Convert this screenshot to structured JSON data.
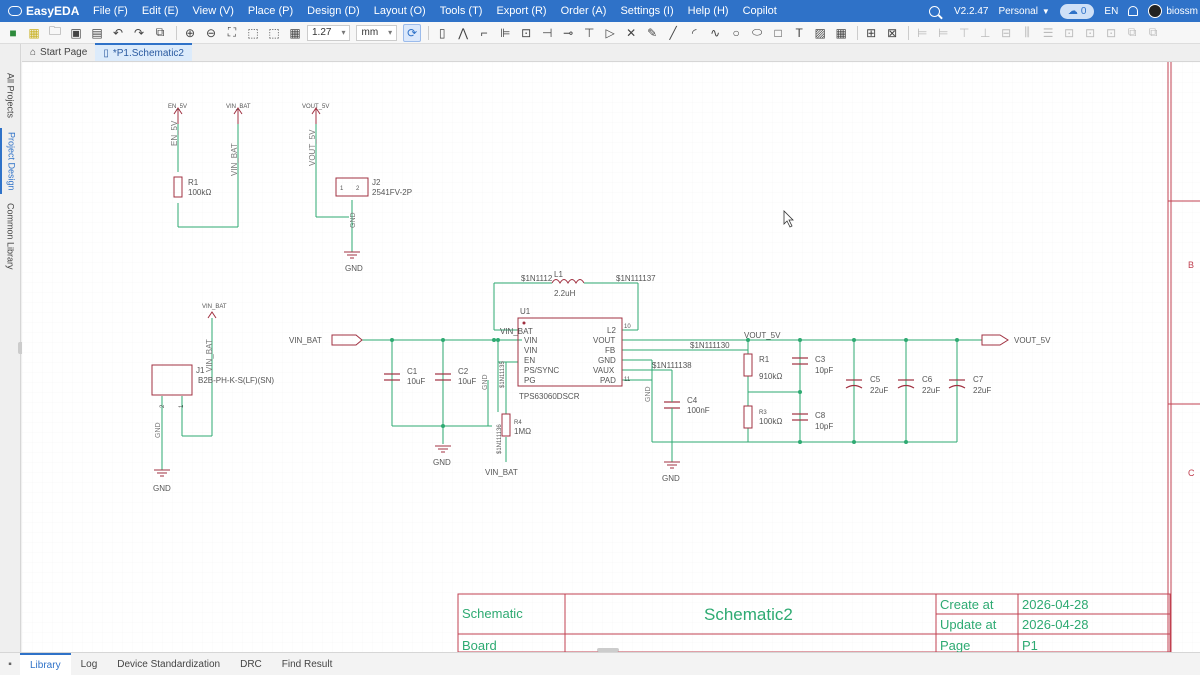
{
  "app": {
    "name": "EasyEDA",
    "version": "V2.2.47",
    "account": "Personal",
    "cloud_count": "0",
    "language": "EN",
    "user": "biossm"
  },
  "menu": [
    "File (F)",
    "Edit (E)",
    "View (V)",
    "Place (P)",
    "Design (D)",
    "Layout (O)",
    "Tools (T)",
    "Export (R)",
    "Order (A)",
    "Settings (I)",
    "Help (H)",
    "Copilot"
  ],
  "toolbar": {
    "grid_value": "1.27",
    "unit": "mm"
  },
  "tabs": [
    {
      "label": "Start Page",
      "icon": "home-icon"
    },
    {
      "label": "*P1.Schematic2",
      "icon": "file-icon"
    }
  ],
  "left_panel": [
    "All Projects",
    "Project Design",
    "Common Library"
  ],
  "bottom_tabs": [
    "Library",
    "Log",
    "Device Standardization",
    "DRC",
    "Find Result"
  ],
  "schematic": {
    "nets": {
      "en_5v": "EN_5V",
      "vin_bat": "VIN_BAT",
      "vout_5v": "VOUT_5V",
      "vout_5v_label": "VOUT_5V",
      "gnd": "GND",
      "n112": "$1N1112",
      "n137": "$1N111137",
      "n130": "$1N111130",
      "n138": "$1N111138",
      "n135": "$1N11135",
      "n136": "$1N111136"
    },
    "r1a": {
      "ref": "R1",
      "value": "100kΩ"
    },
    "j2": {
      "ref": "J2",
      "value": "2541FV-2P",
      "p1": "1",
      "p2": "2"
    },
    "j1": {
      "ref": "J1",
      "value": "B2B-PH-K-S(LF)(SN)",
      "p1": "1",
      "p2": "2"
    },
    "l1": {
      "ref": "L1",
      "value": "2.2uH"
    },
    "u1": {
      "ref": "U1",
      "part": "TPS63060DSCR",
      "left_pins": [
        "VIN",
        "VIN",
        "EN",
        "PS/SYNC",
        "PG"
      ],
      "right_pins": [
        "L2",
        "VOUT",
        "FB",
        "GND",
        "VAUX",
        "PAD"
      ],
      "pin_nums": [
        "1",
        "10",
        "3",
        "4",
        "5",
        "6",
        "7",
        "8",
        "9",
        "11"
      ]
    },
    "caps": {
      "c1": {
        "ref": "C1",
        "value": "10uF"
      },
      "c2": {
        "ref": "C2",
        "value": "10uF"
      },
      "c3": {
        "ref": "C3",
        "value": "10pF"
      },
      "c4": {
        "ref": "C4",
        "value": "100nF"
      },
      "c5": {
        "ref": "C5",
        "value": "22uF"
      },
      "c6": {
        "ref": "C6",
        "value": "22uF"
      },
      "c7": {
        "ref": "C7",
        "value": "22uF"
      },
      "c8": {
        "ref": "C8",
        "value": "10pF"
      }
    },
    "res": {
      "r4": {
        "ref": "R4",
        "value": "1MΩ"
      },
      "r1b": {
        "ref": "R1",
        "value": "910kΩ"
      },
      "r3": {
        "ref": "R3",
        "value": "100kΩ"
      }
    },
    "zones": [
      "B",
      "C"
    ],
    "title_block": {
      "schematic_label": "Schematic",
      "title": "Schematic2",
      "create_label": "Create at",
      "create_date": "2026-04-28",
      "update_label": "Update at",
      "update_date": "2026-04-28",
      "board_label": "Board",
      "page_label": "Page",
      "page_value": "P1"
    }
  },
  "colors": {
    "brand": "#2f72c8",
    "wire": "#2eaa72",
    "component": "#a03040",
    "net_label": "#555555",
    "frame": "#c04050"
  }
}
